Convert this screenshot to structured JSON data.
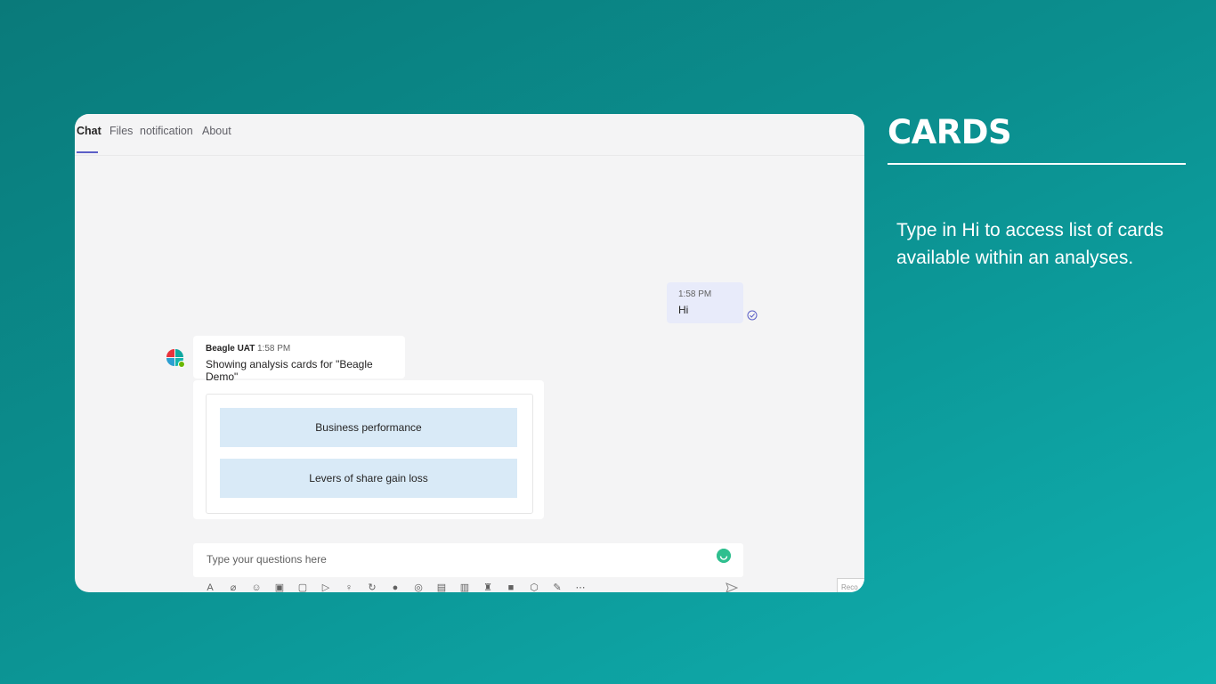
{
  "tabs": [
    {
      "label": "Chat"
    },
    {
      "label": "Files"
    },
    {
      "label": "notification"
    },
    {
      "label": "About"
    }
  ],
  "user_message": {
    "time": "1:58 PM",
    "text": "Hi"
  },
  "bot_message": {
    "sender": "Beagle UAT",
    "time": "1:58 PM",
    "text": "Showing analysis cards for \"Beagle Demo\""
  },
  "cards": [
    {
      "label": "Business performance"
    },
    {
      "label": "Levers of share gain loss"
    }
  ],
  "composer": {
    "placeholder": "Type your questions here",
    "record_label": "Reco"
  },
  "panel": {
    "title": "CARDS",
    "body": "Type in Hi to access list of cards available within an analyses."
  },
  "colors": {
    "accent": "#5b5fc7",
    "card_button": "#d9eaf7",
    "background_teal": "#0b8f8f"
  }
}
